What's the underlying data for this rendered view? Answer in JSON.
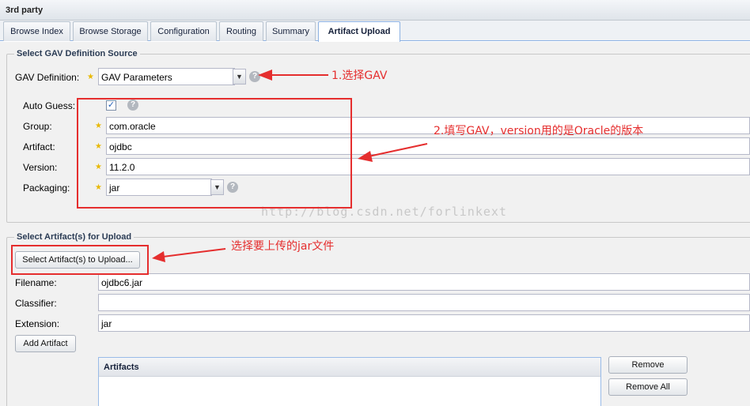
{
  "panel": {
    "title": "3rd party"
  },
  "tabs": [
    {
      "label": "Browse Index"
    },
    {
      "label": "Browse Storage"
    },
    {
      "label": "Configuration"
    },
    {
      "label": "Routing"
    },
    {
      "label": "Summary"
    },
    {
      "label": "Artifact Upload",
      "active": true
    }
  ],
  "gav_source": {
    "legend": "Select GAV Definition Source",
    "definition_label": "GAV Definition:",
    "definition_value": "GAV Parameters",
    "auto_guess_label": "Auto Guess:",
    "auto_guess_checked": true,
    "group_label": "Group:",
    "group_value": "com.oracle",
    "artifact_label": "Artifact:",
    "artifact_value": "ojdbc",
    "version_label": "Version:",
    "version_value": "11.2.0",
    "packaging_label": "Packaging:",
    "packaging_value": "jar"
  },
  "upload": {
    "legend": "Select Artifact(s) for Upload",
    "select_button": "Select Artifact(s) to Upload...",
    "filename_label": "Filename:",
    "filename_value": "ojdbc6.jar",
    "classifier_label": "Classifier:",
    "classifier_value": "",
    "extension_label": "Extension:",
    "extension_value": "jar",
    "add_button": "Add Artifact",
    "artifacts_header": "Artifacts",
    "remove_button": "Remove",
    "remove_all_button": "Remove All"
  },
  "annotations": {
    "note1": "1.选择GAV",
    "note2": "2.填写GAV，version用的是Oracle的版本",
    "note3": "选择要上传的jar文件",
    "watermark": "http://blog.csdn.net/forlinkext"
  },
  "colors": {
    "annotation": "#e52e2e",
    "tab_border": "#8db2e3",
    "star": "#e8b800"
  }
}
